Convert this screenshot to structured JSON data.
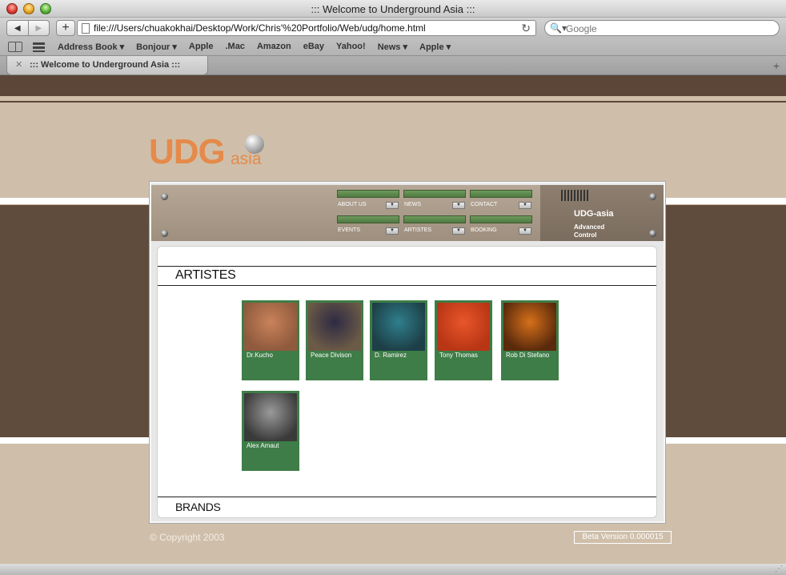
{
  "window": {
    "title": "::: Welcome to Underground Asia :::"
  },
  "toolbar": {
    "back_icon": "◀",
    "forward_icon": "▶",
    "add_icon": "+",
    "url": "file:///Users/chuakokhai/Desktop/Work/Chris'%20Portfolio/Web/udg/home.html",
    "reload_icon": "↻",
    "search_icon": "🔍▾",
    "search_placeholder": "Google"
  },
  "bookmarks": {
    "items": [
      "Address Book ▾",
      "Bonjour ▾",
      "Apple",
      ".Mac",
      "Amazon",
      "eBay",
      "Yahoo!",
      "News ▾",
      "Apple ▾"
    ]
  },
  "tab": {
    "close_icon": "✕",
    "label": "::: Welcome to Underground Asia :::",
    "add_icon": "+"
  },
  "logo": {
    "udg": "UDG",
    "asia": "asia"
  },
  "control_panel": {
    "title": "UDG-asia",
    "subtitle": "Advanced Control",
    "nav": [
      {
        "label": "ABOUT US"
      },
      {
        "label": "NEWS"
      },
      {
        "label": "CONTACT"
      },
      {
        "label": "EVENTS"
      },
      {
        "label": "ARTISTES"
      },
      {
        "label": "BOOKING"
      }
    ]
  },
  "sections": {
    "artistes": "ARTISTES",
    "brands": "BRANDS"
  },
  "artists": [
    {
      "name": "Dr.Kucho",
      "colors": [
        "#c9825a",
        "#8f5a3d"
      ]
    },
    {
      "name": "Peace Divison",
      "colors": [
        "#2e2a44",
        "#6b5a46"
      ]
    },
    {
      "name": "D. Ramirez",
      "colors": [
        "#2f7f8c",
        "#1d3f47"
      ]
    },
    {
      "name": "Tony Thomas",
      "colors": [
        "#e8562a",
        "#b83515"
      ]
    },
    {
      "name": "Rob Di Stefano",
      "colors": [
        "#d6701a",
        "#5a2a0c"
      ]
    },
    {
      "name": "Alex Amaut",
      "colors": [
        "#9a9a9a",
        "#3a3a3a"
      ]
    }
  ],
  "footer": {
    "copyright": "© Copyright 2003",
    "version": "Beta Version 0.000015"
  }
}
